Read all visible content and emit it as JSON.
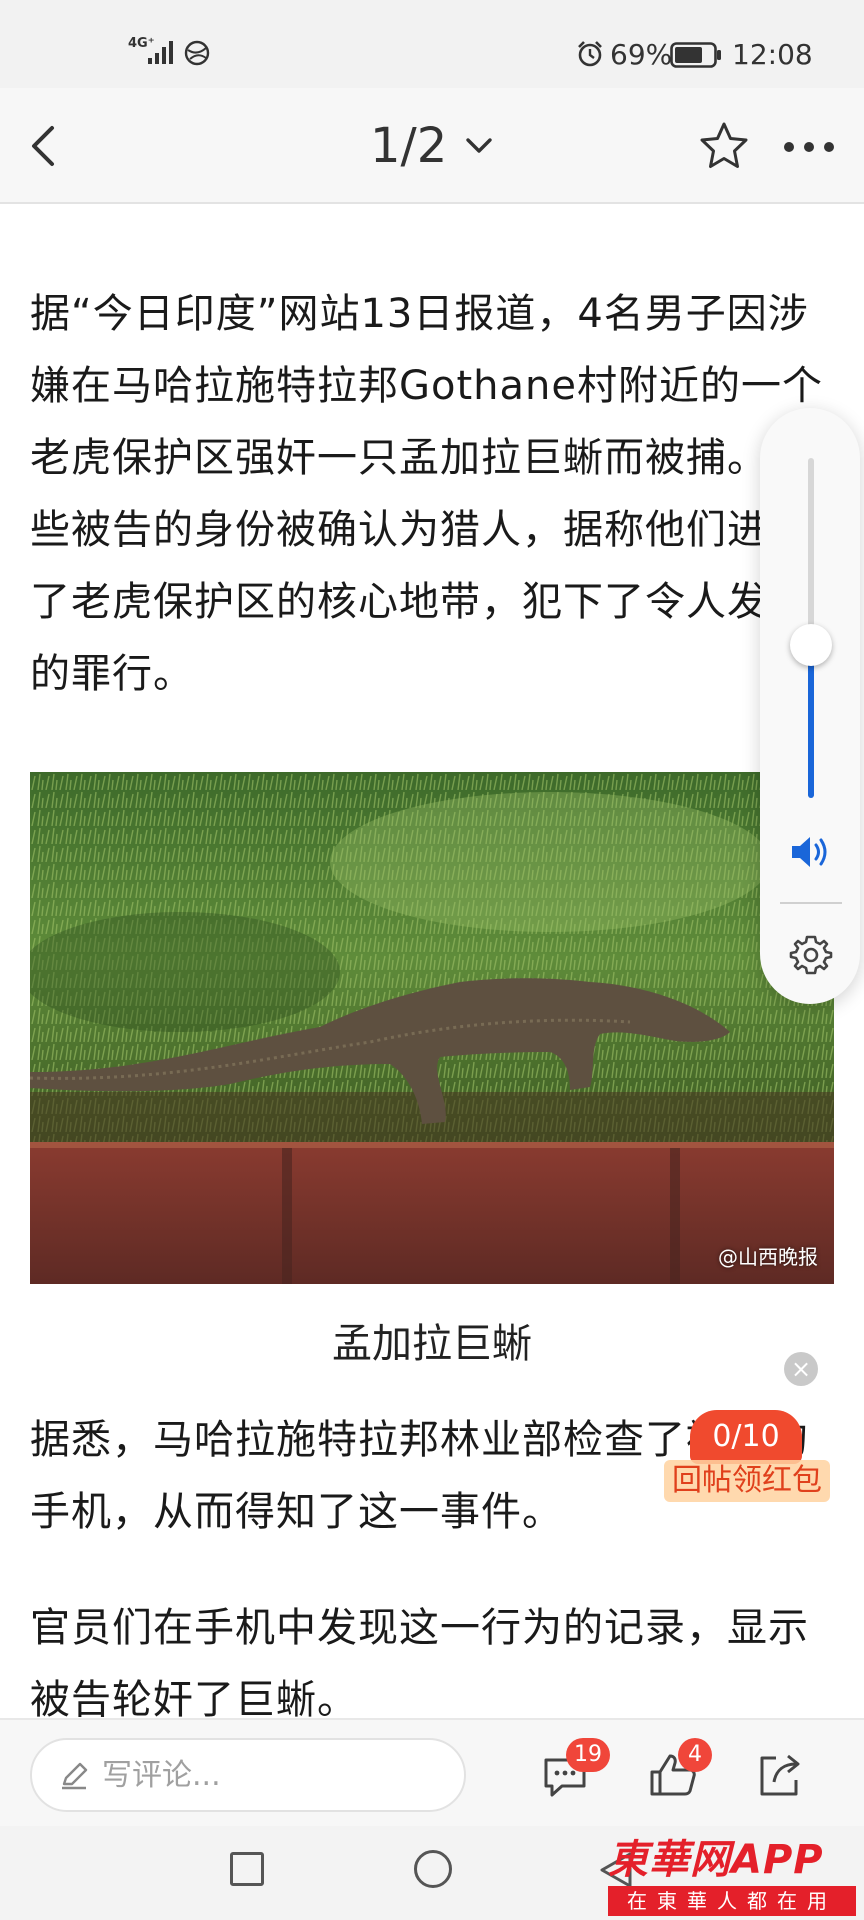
{
  "status_bar": {
    "network": "4G⁺",
    "battery_percent": "69%",
    "time": "12:08"
  },
  "header": {
    "page_indicator": "1/2"
  },
  "article": {
    "para1": "据“今日印度”网站13日报道，4名男子因涉嫌在马哈拉施特拉邦Gothane村附近的一个老虎保护区强奸一只孟加拉巨蜥而被捕。这些被告的身份被确认为猎人，据称他们进入了老虎保护区的核心地带，犯下了令人发指的罪行。",
    "image_watermark": "@山西晚报",
    "caption": "孟加拉巨蜥",
    "para2": "据悉，马哈拉施特拉邦林业部检查了被告的手机，从而得知了这一事件。",
    "para3": "官员们在手机中发现这一行为的记录，显示被告轮奸了巨蜥。"
  },
  "volume": {
    "level": 0.45,
    "accent": "#1a66d9"
  },
  "red_packet": {
    "progress": "0/10",
    "label": "回帖领红包",
    "close": "×"
  },
  "bottom_bar": {
    "comment_placeholder": "写评论...",
    "comment_count": "19",
    "like_count": "4"
  },
  "logo": {
    "main": "東華网APP",
    "sub": "在東華人都在用"
  }
}
